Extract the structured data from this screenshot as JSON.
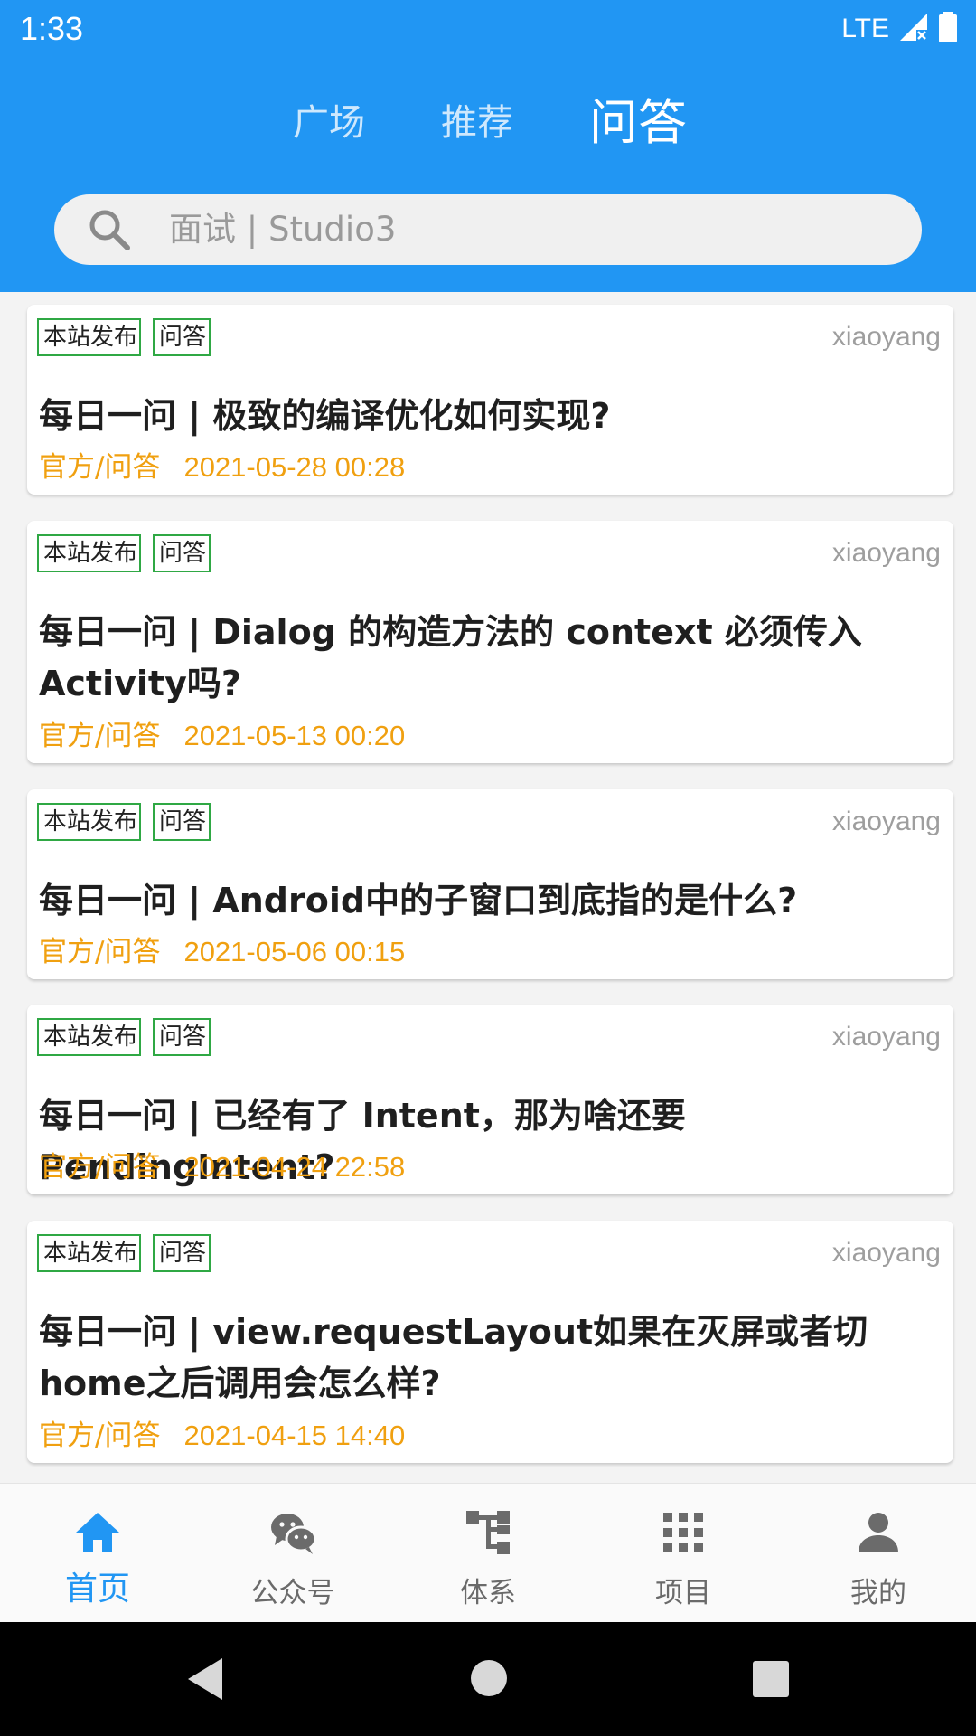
{
  "status_bar": {
    "time": "1:33",
    "network": "LTE"
  },
  "top_tabs": [
    {
      "label": "广场",
      "active": false
    },
    {
      "label": "推荐",
      "active": false
    },
    {
      "label": "问答",
      "active": true
    }
  ],
  "search": {
    "placeholder": "面试 | Studio3",
    "icon": "search-icon"
  },
  "tags": {
    "site": "本站发布",
    "qa": "问答"
  },
  "articles": [
    {
      "author": "xiaoyang",
      "title": "每日一问 | 极致的编译优化如何实现?",
      "category": "官方/问答",
      "date": "2021-05-28 00:28"
    },
    {
      "author": "xiaoyang",
      "title": "每日一问 | Dialog 的构造方法的 context 必须传入 Activity吗?",
      "category": "官方/问答",
      "date": "2021-05-13 00:20"
    },
    {
      "author": "xiaoyang",
      "title": "每日一问 | Android中的子窗口到底指的是什么?",
      "category": "官方/问答",
      "date": "2021-05-06 00:15"
    },
    {
      "author": "xiaoyang",
      "title": "每日一问 | 已经有了 Intent，那为啥还要 PendingIntent?",
      "category": "官方/问答",
      "date": "2021-04-24 22:58"
    },
    {
      "author": "xiaoyang",
      "title": "每日一问 | view.requestLayout如果在灭屏或者切home之后调用会怎么样?",
      "category": "官方/问答",
      "date": "2021-04-15 14:40"
    }
  ],
  "bottom_nav": [
    {
      "label": "首页",
      "icon": "home-icon",
      "active": true
    },
    {
      "label": "公众号",
      "icon": "wechat-icon",
      "active": false
    },
    {
      "label": "体系",
      "icon": "hierarchy-icon",
      "active": false
    },
    {
      "label": "项目",
      "icon": "grid-icon",
      "active": false
    },
    {
      "label": "我的",
      "icon": "person-icon",
      "active": false
    }
  ],
  "colors": {
    "primary": "#2196F3",
    "tag_border": "#2fa844",
    "meta": "#f0a010",
    "author": "#9e9e9e"
  }
}
